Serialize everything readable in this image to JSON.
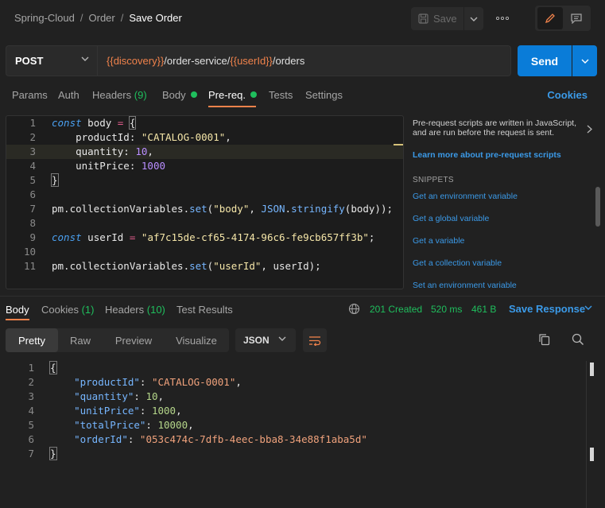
{
  "breadcrumb": {
    "parts": [
      "Spring-Cloud",
      "Order"
    ],
    "current": "Save Order"
  },
  "toolbar": {
    "save_label": "Save",
    "more_label": "ooo"
  },
  "request": {
    "method": "POST",
    "url_parts": [
      {
        "t": "{{",
        "k": "br"
      },
      {
        "t": "discovery",
        "k": "var"
      },
      {
        "t": "}}",
        "k": "br"
      },
      {
        "t": "/order-service/",
        "k": "txt"
      },
      {
        "t": "{{",
        "k": "br"
      },
      {
        "t": "userId",
        "k": "var"
      },
      {
        "t": "}}",
        "k": "br"
      },
      {
        "t": "/orders",
        "k": "txt"
      }
    ],
    "send_label": "Send"
  },
  "request_tabs": {
    "params": "Params",
    "auth": "Auth",
    "headers": "Headers",
    "headers_count": "(9)",
    "body": "Body",
    "prereq": "Pre-req.",
    "tests": "Tests",
    "settings": "Settings",
    "cookies": "Cookies"
  },
  "editor": {
    "line_numbers": [
      "1",
      "2",
      "3",
      "4",
      "5",
      "6",
      "7",
      "8",
      "9",
      "10",
      "11"
    ]
  },
  "side_panel": {
    "description": "Pre-request scripts are written in JavaScript, and are run before the request is sent.",
    "learn_link": "Learn more about pre-request scripts",
    "snippets_heading": "SNIPPETS",
    "snippets": [
      "Get an environment variable",
      "Get a global variable",
      "Get a variable",
      "Get a collection variable",
      "Set an environment variable"
    ]
  },
  "response": {
    "tabs": {
      "body": "Body",
      "cookies": "Cookies",
      "cookies_count": "(1)",
      "headers": "Headers",
      "headers_count": "(10)",
      "tests": "Test Results"
    },
    "status": "201 Created",
    "time": "520 ms",
    "size": "461 B",
    "save_label": "Save Response",
    "views": [
      "Pretty",
      "Raw",
      "Preview",
      "Visualize"
    ],
    "format": "JSON",
    "line_numbers": [
      "1",
      "2",
      "3",
      "4",
      "5",
      "6",
      "7"
    ],
    "body": {
      "productId": "CATALOG-0001",
      "quantity": "10",
      "unitPrice": "1000",
      "totalPrice": "10000",
      "orderId": "053c474c-7dfb-4eec-bba8-34e88f1aba5d"
    }
  },
  "colors": {
    "accent": "#f0824b",
    "primary": "#0a7cd8",
    "success": "#1fbf5d",
    "link": "#3b9ae8"
  }
}
